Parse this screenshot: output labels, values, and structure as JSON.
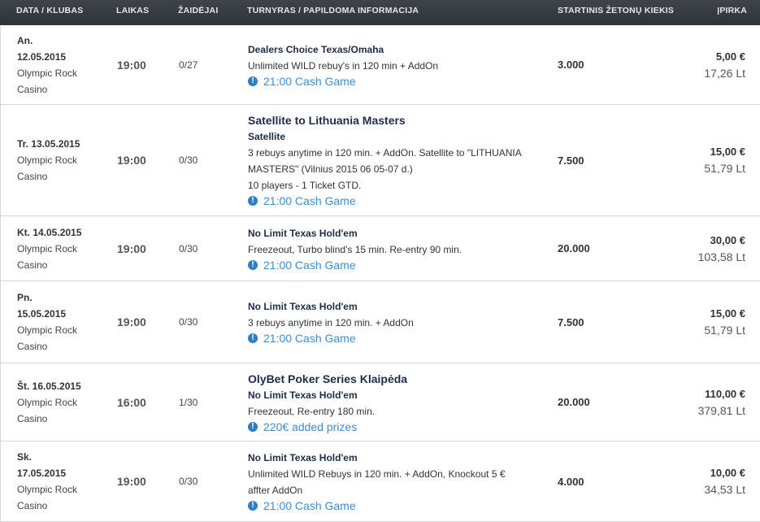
{
  "header": {
    "date_club": "DATA / KLUBAS",
    "time": "LAIKAS",
    "players": "ŽAIDĖJAI",
    "tournament": "TURNYRAS / PAPILDOMA INFORMACIJA",
    "chips": "STARTINIS ŽETONŲ KIEKIS",
    "buyin": "ĮPIRKA"
  },
  "icons": {
    "info": "exclamation-circle-icon",
    "info_color": "#2e7ec2"
  },
  "rows": [
    {
      "date": [
        "An.",
        "12.05.2015",
        "Olympic Rock",
        "Casino"
      ],
      "time": "19:00",
      "players": "0/27",
      "title": "",
      "subtitle": "Dealers Choice Texas/Omaha",
      "desc": [
        "Unlimited WILD rebuy's in 120 min + AddOn"
      ],
      "info": "21:00 Cash Game",
      "chips": "3.000",
      "eur": "5,00 €",
      "lt": "17,26 Lt"
    },
    {
      "date": [
        "Tr. 13.05.2015",
        "Olympic Rock",
        "Casino"
      ],
      "time": "19:00",
      "players": "0/30",
      "title": "Satellite to Lithuania Masters",
      "subtitle": "Satellite",
      "desc": [
        "3 rebuys anytime in 120 min. + AddOn. Satellite to \"LITHUANIA",
        "MASTERS\" (Vilnius 2015 06 05-07 d.)",
        "10 players - 1 Ticket GTD."
      ],
      "info": "21:00 Cash Game",
      "chips": "7.500",
      "eur": "15,00 €",
      "lt": "51,79 Lt"
    },
    {
      "date": [
        "Kt. 14.05.2015",
        "Olympic Rock",
        "Casino"
      ],
      "time": "19:00",
      "players": "0/30",
      "title": "",
      "subtitle": "No Limit Texas Hold'em",
      "desc": [
        "Freezeout, Turbo blind's 15 min. Re-entry 90 min."
      ],
      "info": "21:00 Cash Game",
      "chips": "20.000",
      "eur": "30,00 €",
      "lt": "103,58 Lt"
    },
    {
      "date": [
        "Pn.",
        "15.05.2015",
        "Olympic Rock",
        "Casino"
      ],
      "time": "19:00",
      "players": "0/30",
      "title": "",
      "subtitle": "No Limit Texas Hold'em",
      "desc": [
        "3 rebuys anytime in 120 min. + AddOn"
      ],
      "info": "21:00 Cash Game",
      "chips": "7.500",
      "eur": "15,00 €",
      "lt": "51,79 Lt"
    },
    {
      "date": [
        "Št. 16.05.2015",
        "Olympic Rock",
        "Casino"
      ],
      "time": "16:00",
      "players": "1/30",
      "title": "OlyBet Poker Series Klaipėda",
      "subtitle": "No Limit Texas Hold'em",
      "desc": [
        "Freezeout, Re-entry 180 min."
      ],
      "info": "220€ added prizes",
      "chips": "20.000",
      "eur": "110,00 €",
      "lt": "379,81 Lt"
    },
    {
      "date": [
        "Sk.",
        "17.05.2015",
        "Olympic Rock",
        "Casino"
      ],
      "time": "19:00",
      "players": "0/30",
      "title": "",
      "subtitle": "No Limit Texas Hold'em",
      "desc": [
        "Unlimited WILD Rebuys in 120 min. + AddOn, Knockout 5 €",
        "affter AddOn"
      ],
      "info": "21:00 Cash Game",
      "chips": "4.000",
      "eur": "10,00 €",
      "lt": "34,53 Lt"
    }
  ]
}
